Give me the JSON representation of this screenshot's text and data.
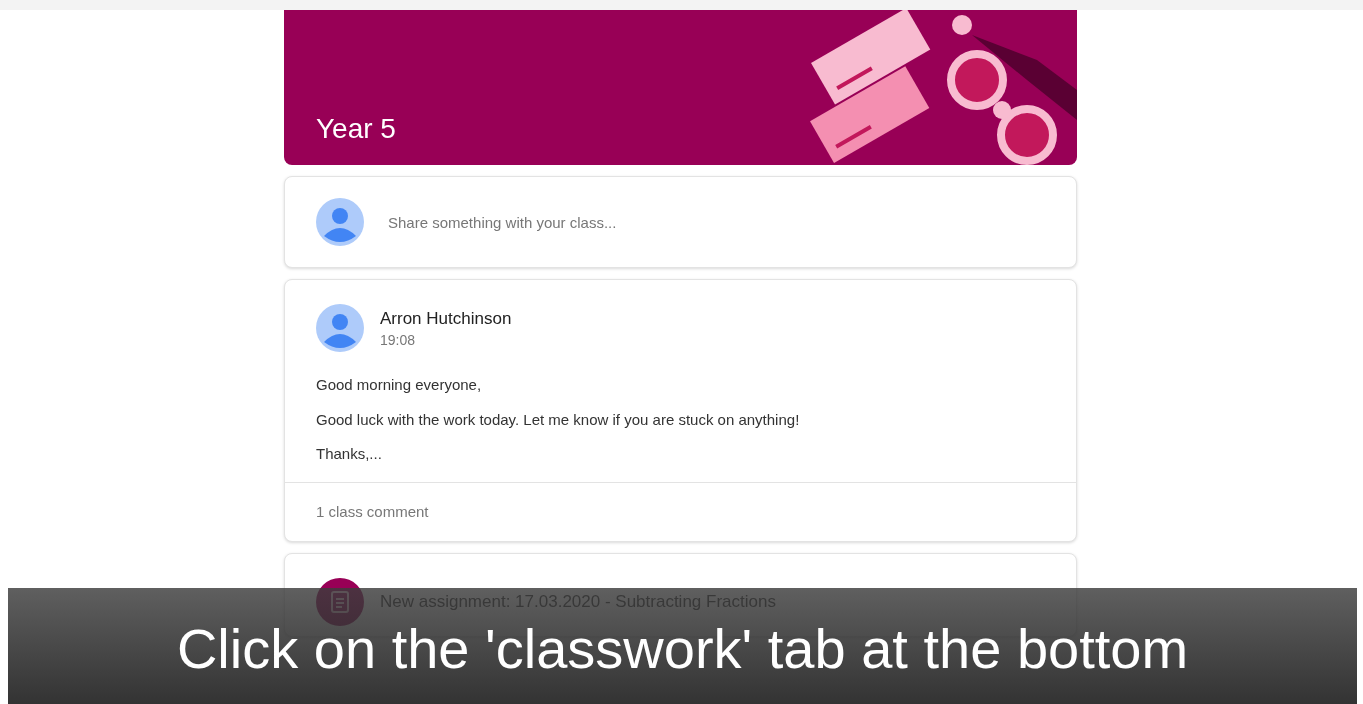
{
  "banner": {
    "title": "Year 5"
  },
  "share_box": {
    "placeholder": "Share something with your class..."
  },
  "post": {
    "author": "Arron Hutchinson",
    "time": "19:08",
    "paragraphs": [
      "Good morning everyone,",
      "Good luck with the work today. Let me know if you are stuck on anything!",
      "Thanks,..."
    ],
    "comments": "1 class comment"
  },
  "assignment": {
    "title": "New assignment: 17.03.2020 - Subtracting Fractions"
  },
  "caption": "Click on the 'classwork' tab at the bottom"
}
